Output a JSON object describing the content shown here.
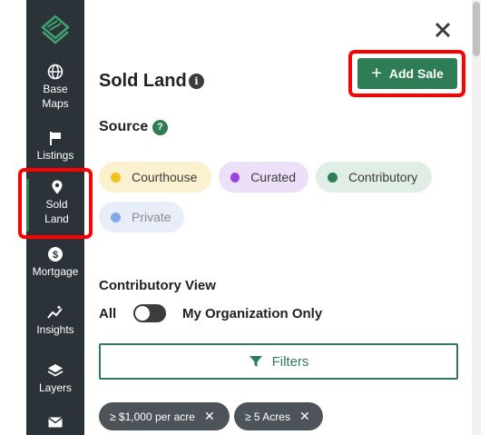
{
  "sidebar": {
    "items": [
      {
        "label_1": "Base",
        "label_2": "Maps",
        "icon": "globe-icon"
      },
      {
        "label_1": "Listings",
        "icon": "flag-icon"
      },
      {
        "label_1": "Sold",
        "label_2": "Land",
        "icon": "map-pin-icon",
        "active": true
      },
      {
        "label_1": "Mortgage",
        "icon": "dollar-icon"
      },
      {
        "label_1": "Insights",
        "icon": "sparkle-chart-icon"
      },
      {
        "label_1": "Layers",
        "icon": "layers-icon"
      },
      {
        "label_1": "",
        "icon": "mail-icon"
      }
    ]
  },
  "panel": {
    "title": "Sold Land",
    "add_sale_label": "Add Sale",
    "source_label": "Source",
    "chips": [
      {
        "label": "Courthouse",
        "color": "#f0c419"
      },
      {
        "label": "Curated",
        "color": "#9b3fe0"
      },
      {
        "label": "Contributory",
        "color": "#2f7d57"
      },
      {
        "label": "Private",
        "color": "#7fa8e8"
      }
    ],
    "contributory_view_label": "Contributory View",
    "toggle_left": "All",
    "toggle_right": "My Organization Only",
    "filters_label": "Filters",
    "active_filters": [
      "≥ $1,000 per acre",
      "≥ 5 Acres"
    ]
  },
  "colors": {
    "accent": "#2f7d57",
    "sidebar": "#2b3338",
    "highlight": "#ff0000"
  }
}
